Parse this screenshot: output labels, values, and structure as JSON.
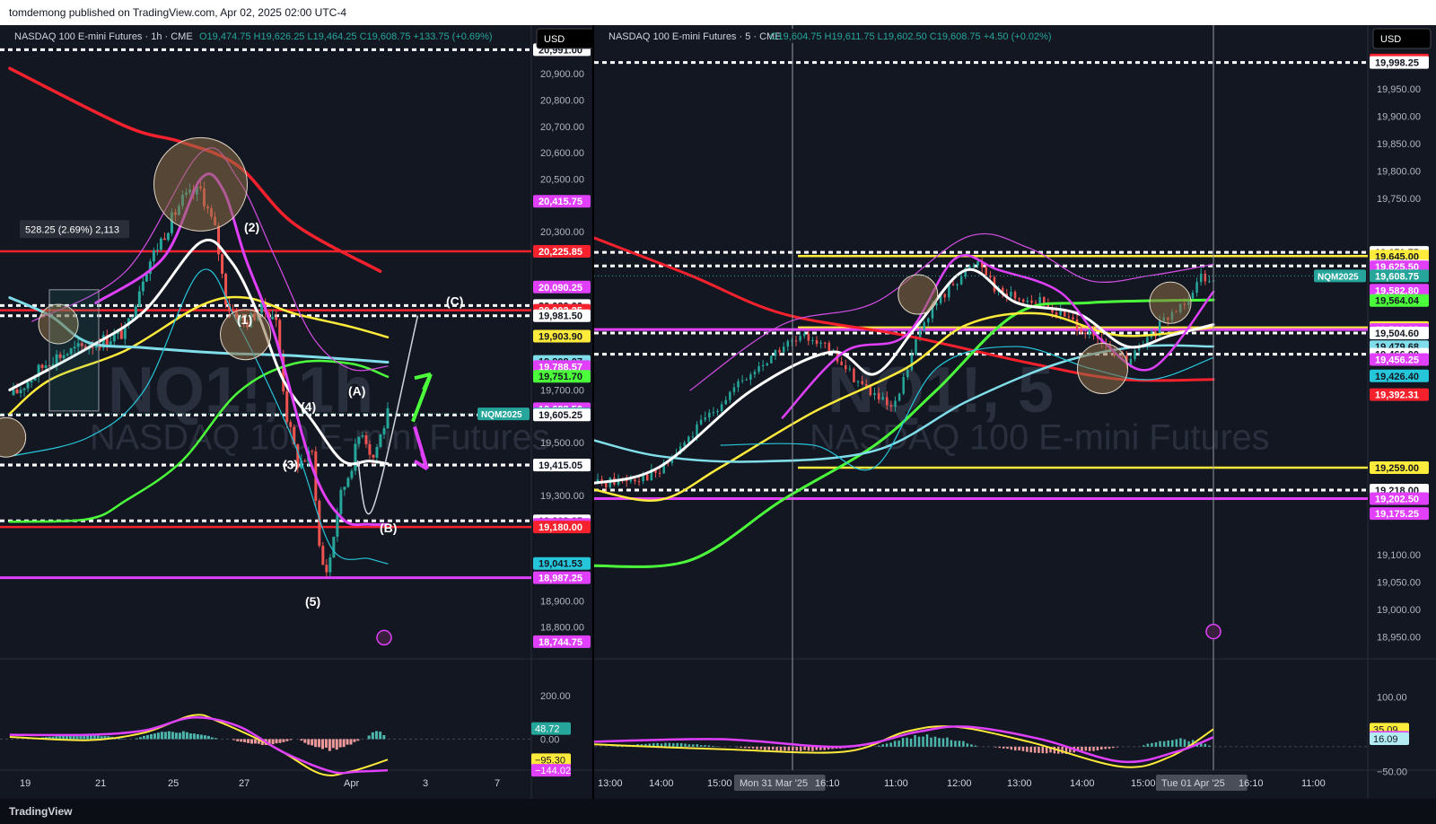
{
  "publisher_line": "tomdemong published on TradingView.com, Apr 02, 2025 02:00 UTC-4",
  "footer_logo": "TradingView",
  "chart_data": [
    {
      "type": "line",
      "instrument": "NASDAQ 100 E-mini Futures · 1h · CME",
      "ohlc": "O19,474.75 H19,626.25 L19,464.25 C19,608.75 +133.75 (+0.69%)",
      "currency": "USD",
      "watermark_symbol": "NQ1!, 1h",
      "watermark_name": "NASDAQ 100 E-mini Futures",
      "ylim": [
        18700,
        21050
      ],
      "ticks_y": [
        {
          "v": 20900,
          "t": "20,900.00"
        },
        {
          "v": 20800,
          "t": "20,800.00"
        },
        {
          "v": 20700,
          "t": "20,700.00"
        },
        {
          "v": 20600,
          "t": "20,600.00"
        },
        {
          "v": 20500,
          "t": "20,500.00"
        },
        {
          "v": 20300,
          "t": "20,300.00"
        },
        {
          "v": 19700,
          "t": "19,700.00"
        },
        {
          "v": 19500,
          "t": "19,500.00"
        },
        {
          "v": 19300,
          "t": "19,300.00"
        },
        {
          "v": 18900,
          "t": "18,900.00"
        },
        {
          "v": 18800,
          "t": "18,800.00"
        }
      ],
      "x_ticks": [
        "19",
        "21",
        "25",
        "27",
        "Apr",
        "3",
        "7"
      ],
      "price_labels": [
        {
          "v": 20991,
          "t": "20,991.00",
          "bg": "#ffffff",
          "fg": "#131722"
        },
        {
          "v": 20415.75,
          "t": "20,415.75",
          "bg": "#e040fb",
          "fg": "#ffffff"
        },
        {
          "v": 20225.85,
          "t": "20,225.85",
          "bg": "#f5222d",
          "fg": "#ffffff"
        },
        {
          "v": 20090.25,
          "t": "20,090.25",
          "bg": "#e040fb",
          "fg": "#ffffff"
        },
        {
          "v": 20020,
          "t": "20,020.00",
          "bg": "#ffffff",
          "fg": "#131722"
        },
        {
          "v": 20002.25,
          "t": "20,002.25",
          "bg": "#f5222d",
          "fg": "#ffffff"
        },
        {
          "v": 19981.5,
          "t": "19,981.50",
          "bg": "#ffffff",
          "fg": "#131722"
        },
        {
          "v": 19903.9,
          "t": "19,903.90",
          "bg": "#ffeb3b",
          "fg": "#131722"
        },
        {
          "v": 19808.07,
          "t": "19,808.07",
          "bg": "#80deea",
          "fg": "#131722"
        },
        {
          "v": 19788.57,
          "t": "19,788.57",
          "bg": "#e040fb",
          "fg": "#ffffff"
        },
        {
          "v": 19751.7,
          "t": "19,751.70",
          "bg": "#4cff3b",
          "fg": "#131722"
        },
        {
          "v": 19628.5,
          "t": "19,628.50",
          "bg": "#e040fb",
          "fg": "#ffffff"
        },
        {
          "v": 19608.75,
          "t": "19,608.75",
          "bg": "#26a69a",
          "fg": "#ffffff"
        },
        {
          "v": 19605.25,
          "t": "19,605.25",
          "bg": "#ffffff",
          "fg": "#131722"
        },
        {
          "v": 19415,
          "t": "19,415.00",
          "bg": "#ffffff",
          "fg": "#131722"
        },
        {
          "v": 19415.05,
          "t": "19,415.05",
          "bg": "#ffffff",
          "fg": "#131722"
        },
        {
          "v": 19203.25,
          "t": "19,203.25",
          "bg": "#ffffff",
          "fg": "#131722"
        },
        {
          "v": 19189.59,
          "t": "19,189.59",
          "bg": "#e040fb",
          "fg": "#ffffff"
        },
        {
          "v": 19180,
          "t": "19,180.00",
          "bg": "#f5222d",
          "fg": "#ffffff"
        },
        {
          "v": 19041.53,
          "t": "19,041.53",
          "bg": "#26c6da",
          "fg": "#131722"
        },
        {
          "v": 18987.25,
          "t": "18,987.25",
          "bg": "#e040fb",
          "fg": "#ffffff"
        },
        {
          "v": 18744.75,
          "t": "18,744.75",
          "bg": "#e040fb",
          "fg": "#ffffff"
        }
      ],
      "symbol_tag": "NQM2025",
      "measure_label": "528.25 (2.69%) 2,113",
      "wave_labels": [
        "(1)",
        "(2)",
        "(3)",
        "(4)",
        "(5)",
        "(A)",
        "(B)",
        "(C)"
      ],
      "oscillator": {
        "ylim": [
          -185,
          230
        ],
        "ticks": [
          {
            "v": 200,
            "t": "200.00"
          },
          {
            "v": 0,
            "t": "0.00"
          }
        ],
        "labels": [
          {
            "v": 48.72,
            "t": "48.72",
            "bg": "#26a69a",
            "fg": "#ffffff"
          },
          {
            "v": -95.3,
            "t": "−95.30",
            "bg": "#ffeb3b",
            "fg": "#131722"
          },
          {
            "v": -144.02,
            "t": "−144.02",
            "bg": "#e040fb",
            "fg": "#ffffff"
          }
        ]
      }
    },
    {
      "type": "line",
      "instrument": "NASDAQ 100 E-mini Futures · 5 · CME",
      "ohlc": "O19,604.75 H19,611.75 L19,602.50 C19,608.75 +4.50 (+0.02%)",
      "currency": "USD",
      "watermark_symbol": "NQ1!, 5",
      "watermark_name": "NASDAQ 100 E-mini Futures",
      "ylim": [
        18920,
        20050
      ],
      "ticks_y": [
        {
          "v": 19950,
          "t": "19,950.00"
        },
        {
          "v": 19900,
          "t": "19,900.00"
        },
        {
          "v": 19850,
          "t": "19,850.00"
        },
        {
          "v": 19800,
          "t": "19,800.00"
        },
        {
          "v": 19750,
          "t": "19,750.00"
        },
        {
          "v": 19100,
          "t": "19,100.00"
        },
        {
          "v": 19050,
          "t": "19,050.00"
        },
        {
          "v": 19000,
          "t": "19,000.00"
        },
        {
          "v": 18950,
          "t": "18,950.00"
        }
      ],
      "x_ticks": [
        "13:00",
        "14:00",
        "15:00",
        "Mon 31 Mar '25",
        "16:10",
        "11:00",
        "12:00",
        "13:00",
        "14:00",
        "15:00",
        "Tue 01 Apr '25",
        "16:10",
        "11:00"
      ],
      "price_labels": [
        {
          "v": 20002.75,
          "t": "20,002.75",
          "bg": "#f5222d",
          "fg": "#ffffff"
        },
        {
          "v": 19998.25,
          "t": "19,998.25",
          "bg": "#ffffff",
          "fg": "#131722"
        },
        {
          "v": 19651.75,
          "t": "19,651.75",
          "bg": "#ffffff",
          "fg": "#131722"
        },
        {
          "v": 19645,
          "t": "19,645.00",
          "bg": "#ffeb3b",
          "fg": "#131722"
        },
        {
          "v": 19627,
          "t": "19,627.00",
          "bg": "#ffffff",
          "fg": "#131722"
        },
        {
          "v": 19625.5,
          "t": "19,625.50",
          "bg": "#e040fb",
          "fg": "#ffffff"
        },
        {
          "v": 19608.75,
          "t": "19,608.75",
          "bg": "#26a69a",
          "fg": "#ffffff"
        },
        {
          "v": 19582.8,
          "t": "19,582.80",
          "bg": "#e040fb",
          "fg": "#ffffff"
        },
        {
          "v": 19564.04,
          "t": "19,564.04",
          "bg": "#4cff3b",
          "fg": "#131722"
        },
        {
          "v": 19514.6,
          "t": "19,514.60",
          "bg": "#ffeb3b",
          "fg": "#131722"
        },
        {
          "v": 19510.92,
          "t": "19,510.92",
          "bg": "#e040fb",
          "fg": "#ffffff"
        },
        {
          "v": 19504.6,
          "t": "19,504.60",
          "bg": "#ffffff",
          "fg": "#131722"
        },
        {
          "v": 19504.6,
          "t": "19,504.60",
          "bg": "#ffffff",
          "fg": "#131722"
        },
        {
          "v": 19479.68,
          "t": "19,479.68",
          "bg": "#80deea",
          "fg": "#131722"
        },
        {
          "v": 19466,
          "t": "19,466.00",
          "bg": "#ffffff",
          "fg": "#131722"
        },
        {
          "v": 19456.25,
          "t": "19,456.25",
          "bg": "#e040fb",
          "fg": "#ffffff"
        },
        {
          "v": 19426.4,
          "t": "19,426.40",
          "bg": "#26c6da",
          "fg": "#131722"
        },
        {
          "v": 19392.31,
          "t": "19,392.31",
          "bg": "#f5222d",
          "fg": "#ffffff"
        },
        {
          "v": 19259,
          "t": "19,259.00",
          "bg": "#ffeb3b",
          "fg": "#131722"
        },
        {
          "v": 19218,
          "t": "19,218.00",
          "bg": "#ffffff",
          "fg": "#131722"
        },
        {
          "v": 19202.5,
          "t": "19,202.50",
          "bg": "#e040fb",
          "fg": "#ffffff"
        },
        {
          "v": 19175.25,
          "t": "19,175.25",
          "bg": "#e040fb",
          "fg": "#ffffff"
        }
      ],
      "symbol_tag": "NQM2025",
      "oscillator": {
        "ylim": [
          -65,
          115
        ],
        "ticks": [
          {
            "v": 100,
            "t": "100.00"
          },
          {
            "v": -50,
            "t": "−50.00"
          }
        ],
        "labels": [
          {
            "v": 35.09,
            "t": "35.09",
            "bg": "#ffeb3b",
            "fg": "#131722"
          },
          {
            "v": 19,
            "t": "19.00",
            "bg": "#e040fb",
            "fg": "#ffffff"
          },
          {
            "v": 16.09,
            "t": "16.09",
            "bg": "#b2ebf2",
            "fg": "#131722"
          }
        ]
      }
    }
  ]
}
